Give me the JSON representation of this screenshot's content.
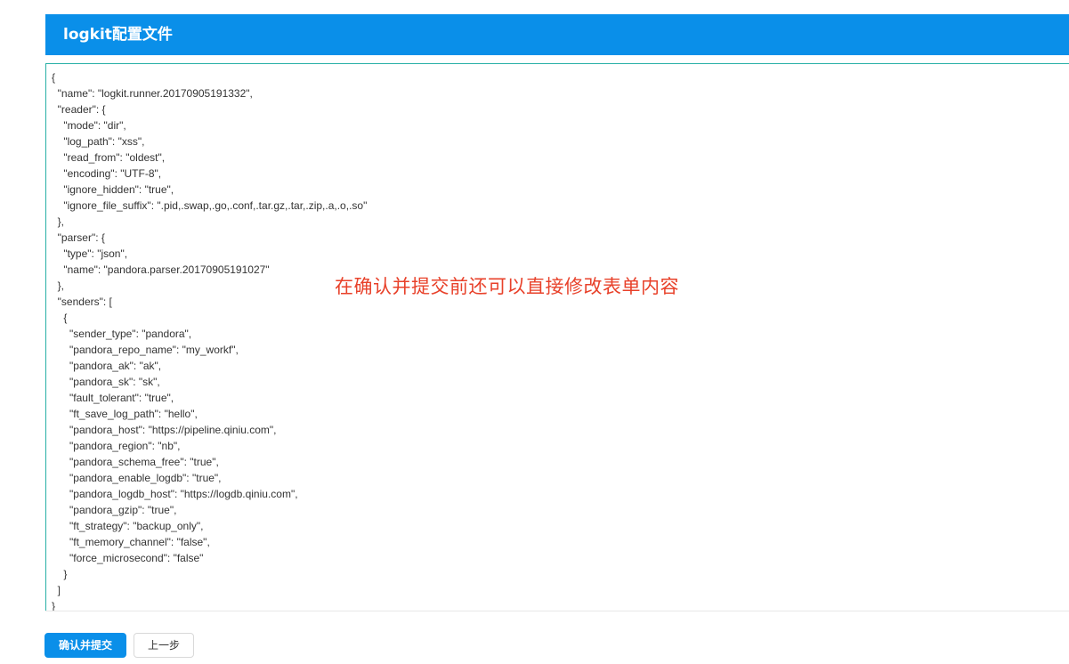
{
  "header": {
    "title": "logkit配置文件"
  },
  "editor": {
    "content": "{\n  \"name\": \"logkit.runner.20170905191332\",\n  \"reader\": {\n    \"mode\": \"dir\",\n    \"log_path\": \"xss\",\n    \"read_from\": \"oldest\",\n    \"encoding\": \"UTF-8\",\n    \"ignore_hidden\": \"true\",\n    \"ignore_file_suffix\": \".pid,.swap,.go,.conf,.tar.gz,.tar,.zip,.a,.o,.so\"\n  },\n  \"parser\": {\n    \"type\": \"json\",\n    \"name\": \"pandora.parser.20170905191027\"\n  },\n  \"senders\": [\n    {\n      \"sender_type\": \"pandora\",\n      \"pandora_repo_name\": \"my_workf\",\n      \"pandora_ak\": \"ak\",\n      \"pandora_sk\": \"sk\",\n      \"fault_tolerant\": \"true\",\n      \"ft_save_log_path\": \"hello\",\n      \"pandora_host\": \"https://pipeline.qiniu.com\",\n      \"pandora_region\": \"nb\",\n      \"pandora_schema_free\": \"true\",\n      \"pandora_enable_logdb\": \"true\",\n      \"pandora_logdb_host\": \"https://logdb.qiniu.com\",\n      \"pandora_gzip\": \"true\",\n      \"ft_strategy\": \"backup_only\",\n      \"ft_memory_channel\": \"false\",\n      \"force_microsecond\": \"false\"\n    }\n  ]\n}"
  },
  "annotation": {
    "text": "在确认并提交前还可以直接修改表单内容"
  },
  "actions": {
    "confirm_label": "确认并提交",
    "back_label": "上一步"
  },
  "colors": {
    "primary": "#0a8fe9",
    "editor_border": "#27b0a6",
    "annotation": "#e8412a"
  }
}
